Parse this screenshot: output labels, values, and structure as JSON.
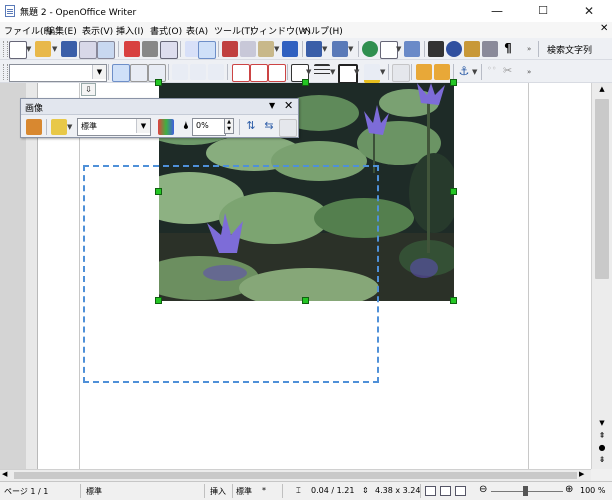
{
  "window": {
    "title": "無題 2 - OpenOffice Writer",
    "minimize": "—",
    "maximize": "☐",
    "close": "✕"
  },
  "menu": [
    "ファイル(F)",
    "編集(E)",
    "表示(V)",
    "挿入(I)",
    "書式(O)",
    "表(A)",
    "ツール(T)",
    "ウィンドウ(W)",
    "ヘルプ(H)"
  ],
  "toolbar": {
    "find_text": "検索文字列",
    "paragraph_style": ""
  },
  "image_toolbar": {
    "title": "画像",
    "graphics_mode": "標準",
    "transparency": "0%"
  },
  "statusbar": {
    "page": "ページ 1 / 1",
    "style": "標準",
    "insert_mode": "挿入",
    "selection_mode": "標準",
    "position": "0.04 / 1.21",
    "size": "4.38 x 3.24",
    "zoom": "100 %"
  },
  "colors": {
    "accent": "#4f90d8",
    "handle": "#24c624",
    "toolbar_bg": "#eef0f4"
  }
}
